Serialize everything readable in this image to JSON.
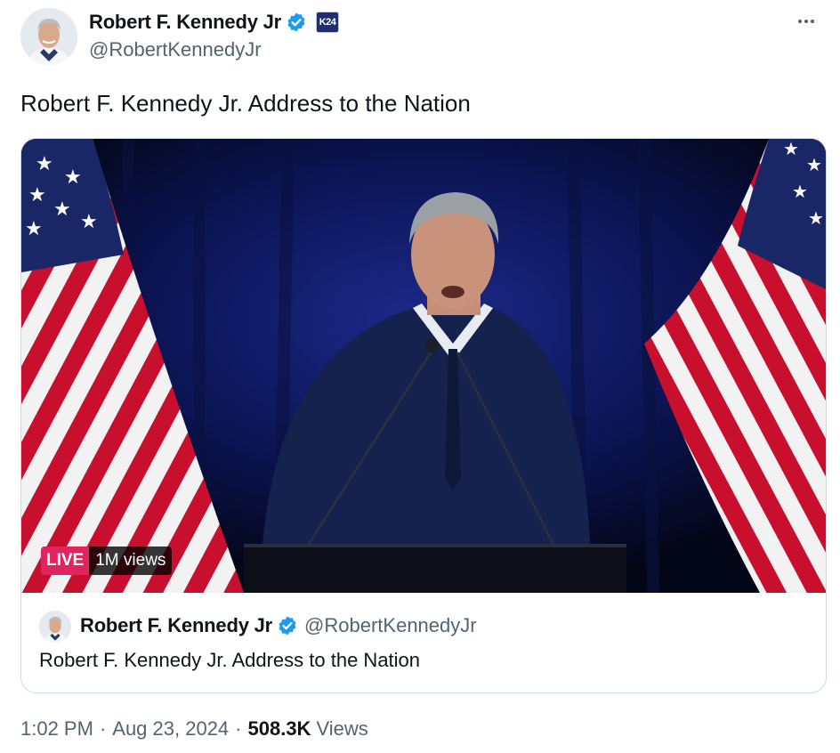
{
  "author": {
    "display_name": "Robert F. Kennedy Jr",
    "handle": "@RobertKennedyJr",
    "avatar_icon": "profile-photo",
    "verified_icon": "verified-badge-icon",
    "affiliation_badge_text": "K24"
  },
  "more_menu_icon": "more-options-icon",
  "tweet": {
    "text": "Robert F. Kennedy Jr. Address to the Nation"
  },
  "media": {
    "live_label": "LIVE",
    "views_label": "1M views"
  },
  "quoted": {
    "display_name": "Robert F. Kennedy Jr",
    "handle": "@RobertKennedyJr",
    "text": "Robert F. Kennedy Jr. Address to the Nation"
  },
  "meta": {
    "time": "1:02 PM",
    "separator": "·",
    "date": "Aug 23, 2024",
    "views_count": "508.3K",
    "views_label": "Views"
  },
  "colors": {
    "text_primary": "#0f1419",
    "text_secondary": "#536471",
    "verified_blue": "#1d9bf0",
    "live_red": "#e0245e",
    "border": "#cfd9de"
  }
}
